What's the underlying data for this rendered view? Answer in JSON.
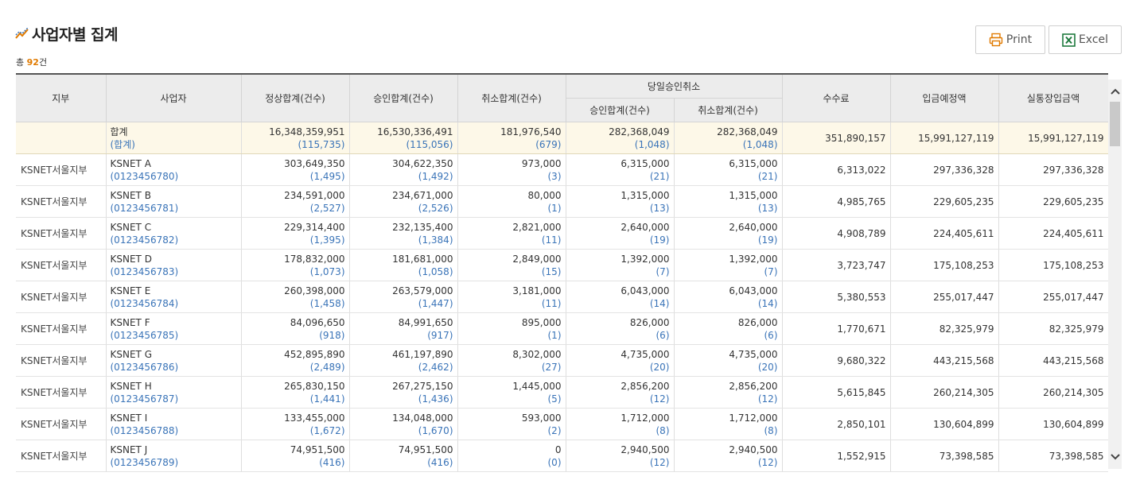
{
  "page": {
    "title": "사업자별 집계",
    "count_prefix": "총 ",
    "count_value": "92",
    "count_suffix": "건"
  },
  "buttons": {
    "print": "Print",
    "excel": "Excel"
  },
  "columns": {
    "branch": "지부",
    "merchant": "사업자",
    "normal_total": "정상합계(건수)",
    "approval_total": "승인합계(건수)",
    "cancel_total": "취소합계(건수)",
    "sameday_group": "당일승인취소",
    "sameday_approval": "승인합계(건수)",
    "sameday_cancel": "취소합계(건수)",
    "fee": "수수료",
    "deposit_expected": "입금예정액",
    "actual_deposit": "실통장입금액"
  },
  "total_row": {
    "label": "합계",
    "label_sub": "(합계)",
    "normal": "16,348,359,951",
    "normal_cnt": "(115,735)",
    "approval": "16,530,336,491",
    "approval_cnt": "(115,056)",
    "cancel": "181,976,540",
    "cancel_cnt": "(679)",
    "sd_approval": "282,368,049",
    "sd_approval_cnt": "(1,048)",
    "sd_cancel": "282,368,049",
    "sd_cancel_cnt": "(1,048)",
    "fee": "351,890,157",
    "deposit": "15,991,127,119",
    "actual": "15,991,127,119"
  },
  "rows": [
    {
      "branch": "KSNET서울지부",
      "name": "KSNET A",
      "id": "(0123456780)",
      "normal": "303,649,350",
      "normal_cnt": "(1,495)",
      "approval": "304,622,350",
      "approval_cnt": "(1,492)",
      "cancel": "973,000",
      "cancel_cnt": "(3)",
      "sd_approval": "6,315,000",
      "sd_approval_cnt": "(21)",
      "sd_cancel": "6,315,000",
      "sd_cancel_cnt": "(21)",
      "fee": "6,313,022",
      "deposit": "297,336,328",
      "actual": "297,336,328"
    },
    {
      "branch": "KSNET서울지부",
      "name": "KSNET B",
      "id": "(0123456781)",
      "normal": "234,591,000",
      "normal_cnt": "(2,527)",
      "approval": "234,671,000",
      "approval_cnt": "(2,526)",
      "cancel": "80,000",
      "cancel_cnt": "(1)",
      "sd_approval": "1,315,000",
      "sd_approval_cnt": "(13)",
      "sd_cancel": "1,315,000",
      "sd_cancel_cnt": "(13)",
      "fee": "4,985,765",
      "deposit": "229,605,235",
      "actual": "229,605,235"
    },
    {
      "branch": "KSNET서울지부",
      "name": "KSNET C",
      "id": "(0123456782)",
      "normal": "229,314,400",
      "normal_cnt": "(1,395)",
      "approval": "232,135,400",
      "approval_cnt": "(1,384)",
      "cancel": "2,821,000",
      "cancel_cnt": "(11)",
      "sd_approval": "2,640,000",
      "sd_approval_cnt": "(19)",
      "sd_cancel": "2,640,000",
      "sd_cancel_cnt": "(19)",
      "fee": "4,908,789",
      "deposit": "224,405,611",
      "actual": "224,405,611"
    },
    {
      "branch": "KSNET서울지부",
      "name": "KSNET D",
      "id": "(0123456783)",
      "normal": "178,832,000",
      "normal_cnt": "(1,073)",
      "approval": "181,681,000",
      "approval_cnt": "(1,058)",
      "cancel": "2,849,000",
      "cancel_cnt": "(15)",
      "sd_approval": "1,392,000",
      "sd_approval_cnt": "(7)",
      "sd_cancel": "1,392,000",
      "sd_cancel_cnt": "(7)",
      "fee": "3,723,747",
      "deposit": "175,108,253",
      "actual": "175,108,253"
    },
    {
      "branch": "KSNET서울지부",
      "name": "KSNET E",
      "id": "(0123456784)",
      "normal": "260,398,000",
      "normal_cnt": "(1,458)",
      "approval": "263,579,000",
      "approval_cnt": "(1,447)",
      "cancel": "3,181,000",
      "cancel_cnt": "(11)",
      "sd_approval": "6,043,000",
      "sd_approval_cnt": "(14)",
      "sd_cancel": "6,043,000",
      "sd_cancel_cnt": "(14)",
      "fee": "5,380,553",
      "deposit": "255,017,447",
      "actual": "255,017,447"
    },
    {
      "branch": "KSNET서울지부",
      "name": "KSNET F",
      "id": "(0123456785)",
      "normal": "84,096,650",
      "normal_cnt": "(918)",
      "approval": "84,991,650",
      "approval_cnt": "(917)",
      "cancel": "895,000",
      "cancel_cnt": "(1)",
      "sd_approval": "826,000",
      "sd_approval_cnt": "(6)",
      "sd_cancel": "826,000",
      "sd_cancel_cnt": "(6)",
      "fee": "1,770,671",
      "deposit": "82,325,979",
      "actual": "82,325,979"
    },
    {
      "branch": "KSNET서울지부",
      "name": "KSNET G",
      "id": "(0123456786)",
      "normal": "452,895,890",
      "normal_cnt": "(2,489)",
      "approval": "461,197,890",
      "approval_cnt": "(2,462)",
      "cancel": "8,302,000",
      "cancel_cnt": "(27)",
      "sd_approval": "4,735,000",
      "sd_approval_cnt": "(20)",
      "sd_cancel": "4,735,000",
      "sd_cancel_cnt": "(20)",
      "fee": "9,680,322",
      "deposit": "443,215,568",
      "actual": "443,215,568"
    },
    {
      "branch": "KSNET서울지부",
      "name": "KSNET H",
      "id": "(0123456787)",
      "normal": "265,830,150",
      "normal_cnt": "(1,441)",
      "approval": "267,275,150",
      "approval_cnt": "(1,436)",
      "cancel": "1,445,000",
      "cancel_cnt": "(5)",
      "sd_approval": "2,856,200",
      "sd_approval_cnt": "(12)",
      "sd_cancel": "2,856,200",
      "sd_cancel_cnt": "(12)",
      "fee": "5,615,845",
      "deposit": "260,214,305",
      "actual": "260,214,305"
    },
    {
      "branch": "KSNET서울지부",
      "name": "KSNET I",
      "id": "(0123456788)",
      "normal": "133,455,000",
      "normal_cnt": "(1,672)",
      "approval": "134,048,000",
      "approval_cnt": "(1,670)",
      "cancel": "593,000",
      "cancel_cnt": "(2)",
      "sd_approval": "1,712,000",
      "sd_approval_cnt": "(8)",
      "sd_cancel": "1,712,000",
      "sd_cancel_cnt": "(8)",
      "fee": "2,850,101",
      "deposit": "130,604,899",
      "actual": "130,604,899"
    },
    {
      "branch": "KSNET서울지부",
      "name": "KSNET J",
      "id": "(0123456789)",
      "normal": "74,951,500",
      "normal_cnt": "(416)",
      "approval": "74,951,500",
      "approval_cnt": "(416)",
      "cancel": "0",
      "cancel_cnt": "(0)",
      "sd_approval": "2,940,500",
      "sd_approval_cnt": "(12)",
      "sd_cancel": "2,940,500",
      "sd_cancel_cnt": "(12)",
      "fee": "1,552,915",
      "deposit": "73,398,585",
      "actual": "73,398,585"
    }
  ],
  "colors": {
    "accent_count": "#e07a00",
    "link_blue": "#3a74b8",
    "total_bg": "#fdf8e8",
    "header_bg": "#ececec"
  },
  "icons": {
    "title": "chart-line-icon",
    "print": "printer-icon",
    "excel": "excel-icon",
    "scroll_up": "chevron-up-icon",
    "scroll_down": "chevron-down-icon"
  }
}
